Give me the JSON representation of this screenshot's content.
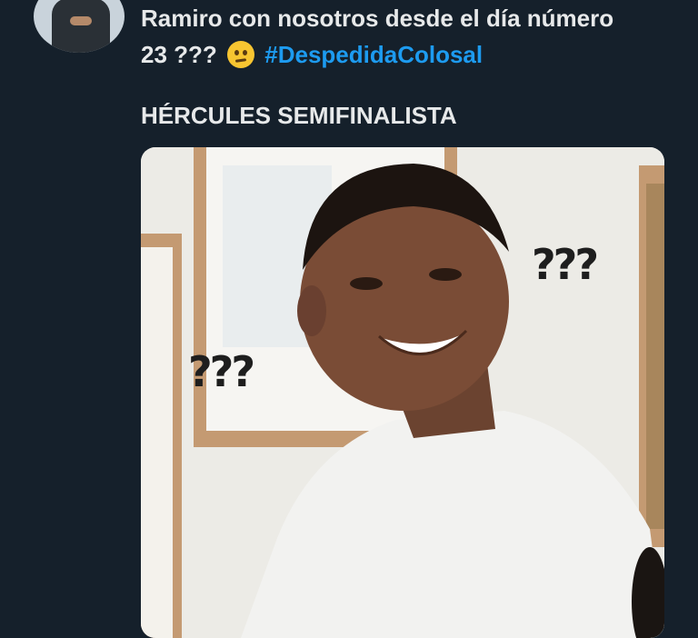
{
  "tweet": {
    "text_line1": "Ramiro con nosotros desde el día número",
    "text_line2_prefix": "23 ???",
    "emoji": "raised-eyebrow-emoji",
    "hashtag": "#DespedidaColosal",
    "subtitle": "HÉRCULES SEMIFINALISTA"
  },
  "media": {
    "question_marks_left": "???",
    "question_marks_right": "???"
  },
  "colors": {
    "background": "#15202b",
    "text": "#e7e9ea",
    "hashtag": "#1d9bf0"
  }
}
